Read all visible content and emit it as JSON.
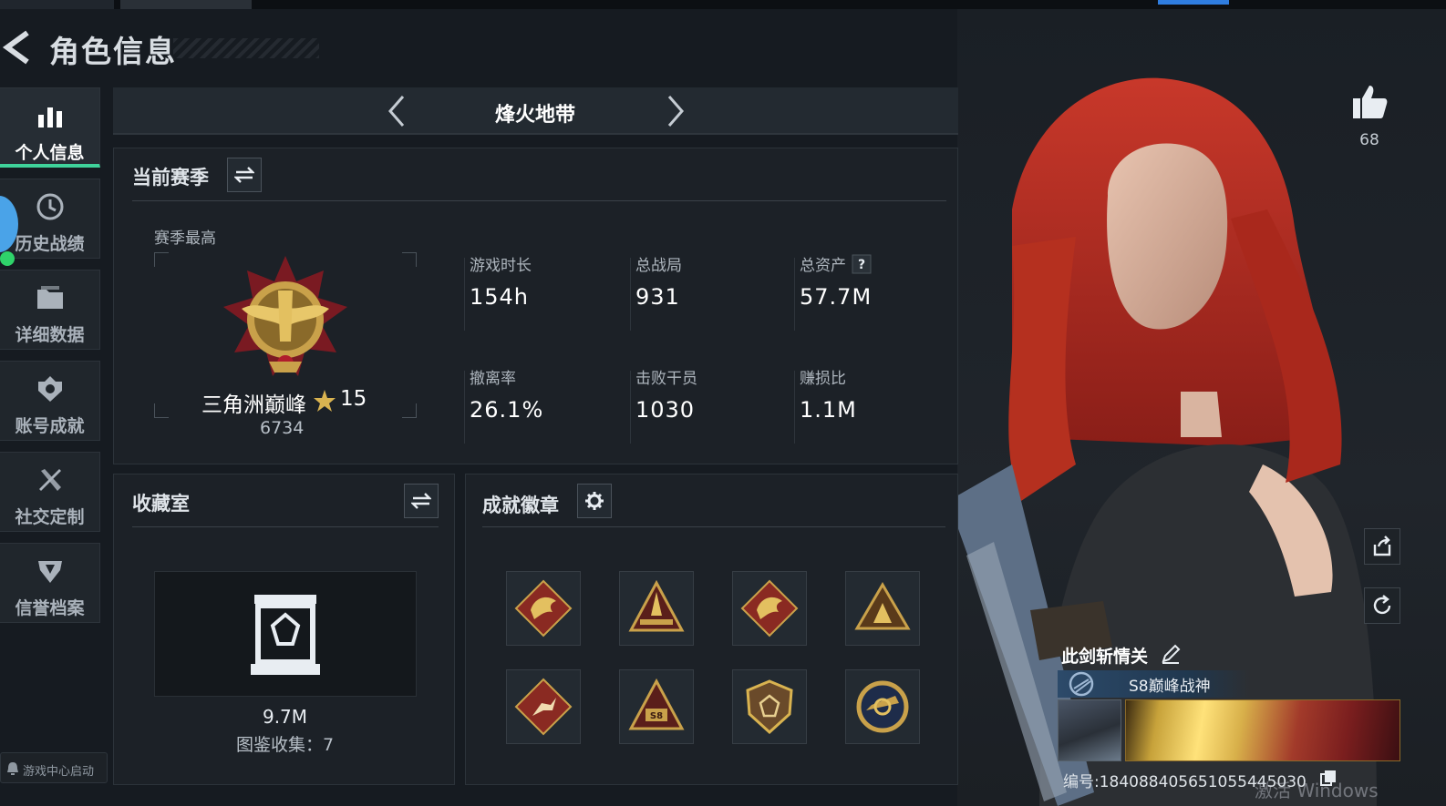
{
  "header": {
    "title": "角色信息"
  },
  "sidebar": {
    "items": [
      {
        "label": "个人信息",
        "icon": "bar-chart-icon",
        "active": true
      },
      {
        "label": "历史战绩",
        "icon": "history-clock-icon"
      },
      {
        "label": "详细数据",
        "icon": "folder-icon"
      },
      {
        "label": "账号成就",
        "icon": "achievement-icon"
      },
      {
        "label": "社交定制",
        "icon": "tools-icon"
      },
      {
        "label": "信誉档案",
        "icon": "shield-crest-icon"
      }
    ],
    "game_center": "游戏中心启动"
  },
  "mode": {
    "title": "烽火地带"
  },
  "season": {
    "title": "当前赛季",
    "subtitle": "赛季最高",
    "rank_name": "三角洲巅峰",
    "rank_level": "15",
    "rank_score": "6734",
    "stats": [
      {
        "label": "游戏时长",
        "value": "154h"
      },
      {
        "label": "总战局",
        "value": "931"
      },
      {
        "label": "总资产",
        "value": "57.7M",
        "help": true
      },
      {
        "label": "撤离率",
        "value": "26.1%"
      },
      {
        "label": "击败干员",
        "value": "1030"
      },
      {
        "label": "赚损比",
        "value": "1.1M"
      }
    ]
  },
  "collection": {
    "title": "收藏室",
    "value": "9.7M",
    "count_label": "图鉴收集：7"
  },
  "achievements": {
    "title": "成就徽章",
    "badges": [
      "dragon-badge-icon",
      "rocket-badge-icon",
      "dragon-badge-icon",
      "camp-badge-icon",
      "runner-badge-icon",
      "s8-badge-icon",
      "diamond-shield-badge-icon",
      "emblem-badge-icon"
    ]
  },
  "social": {
    "likes": "68"
  },
  "player": {
    "name": "此剑斩情关",
    "title": "S8巅峰战神",
    "id_text": "编号:184088405651055445030"
  },
  "watermark": "激活 Windows",
  "colors": {
    "accent": "#3fd39b",
    "background": "#161b21",
    "panel": "#1c2127",
    "gold": "#c9a14a"
  }
}
